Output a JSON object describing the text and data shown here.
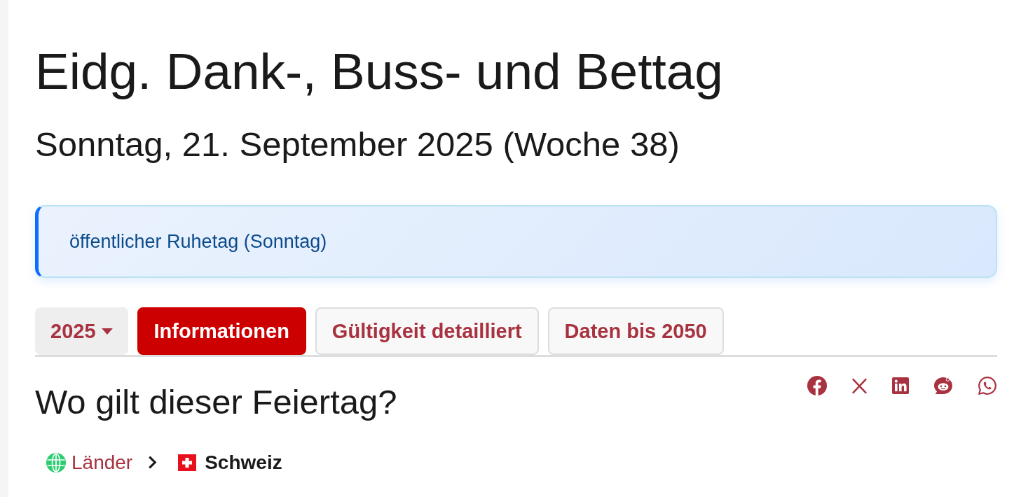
{
  "page": {
    "title": "Eidg. Dank-, Buss- und Bettag",
    "subtitle": "Sonntag, 21. September 2025 (Woche 38)"
  },
  "notice": {
    "text": "öffentlicher Ruhetag (Sonntag)"
  },
  "tabs": [
    {
      "kind": "dropdown",
      "label": "2025",
      "selected": false
    },
    {
      "kind": "tab",
      "label": "Informationen",
      "selected": true
    },
    {
      "kind": "tab",
      "label": "Gültigkeit detailliert",
      "selected": false
    },
    {
      "kind": "tab",
      "label": "Daten bis 2050",
      "selected": false
    }
  ],
  "section": {
    "heading": "Wo gilt dieser Feiertag?"
  },
  "breadcrumb": [
    {
      "kind": "link",
      "label": "Länder"
    },
    {
      "kind": "current",
      "label": "Schweiz"
    }
  ]
}
